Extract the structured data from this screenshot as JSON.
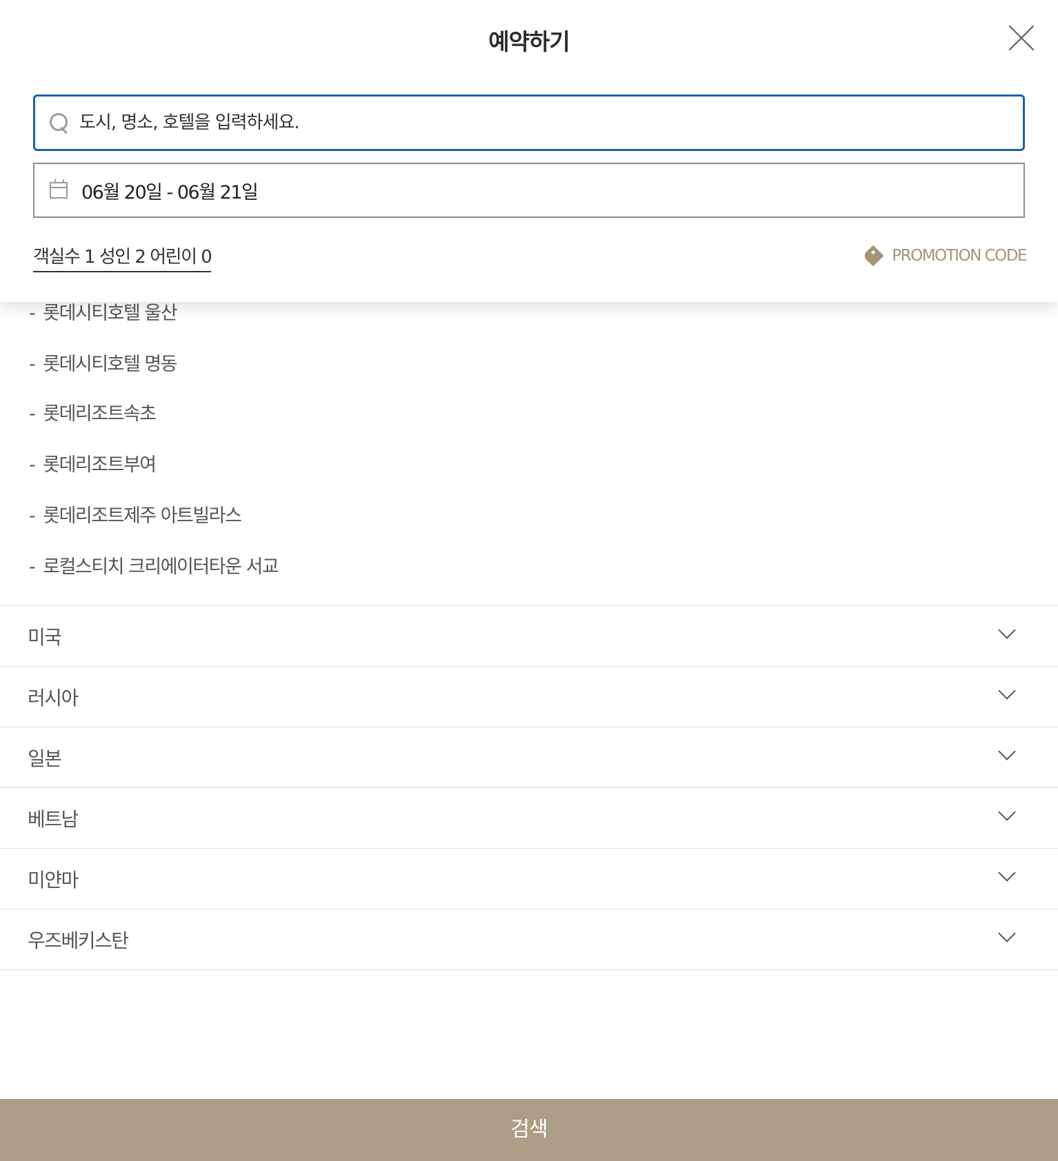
{
  "modal": {
    "title": "예약하기"
  },
  "search": {
    "placeholder": "도시, 명소, 호텔을 입력하세요.",
    "value": ""
  },
  "dates": {
    "range": "06월 20일 - 06월 21일"
  },
  "guests": {
    "summary": "객실수 1 성인 2 어린이 0"
  },
  "promotion": {
    "label": "PROMOTION CODE"
  },
  "hotels": [
    "롯데시티호텔 울산",
    "롯데시티호텔 명동",
    "롯데리조트속초",
    "롯데리조트부여",
    "롯데리조트제주 아트빌라스",
    "로컬스티치 크리에이터타운 서교"
  ],
  "hotel_prefix": "-",
  "countries": [
    "미국",
    "러시아",
    "일본",
    "베트남",
    "미얀마",
    "우즈베키스탄"
  ],
  "footer": {
    "search_label": "검색"
  },
  "colors": {
    "accent_border": "#1f5fad",
    "brand": "#ac9d86",
    "promo": "#a69479"
  },
  "icons": [
    "close-icon",
    "search-icon",
    "calendar-icon",
    "tag-icon",
    "chevron-down-icon"
  ]
}
